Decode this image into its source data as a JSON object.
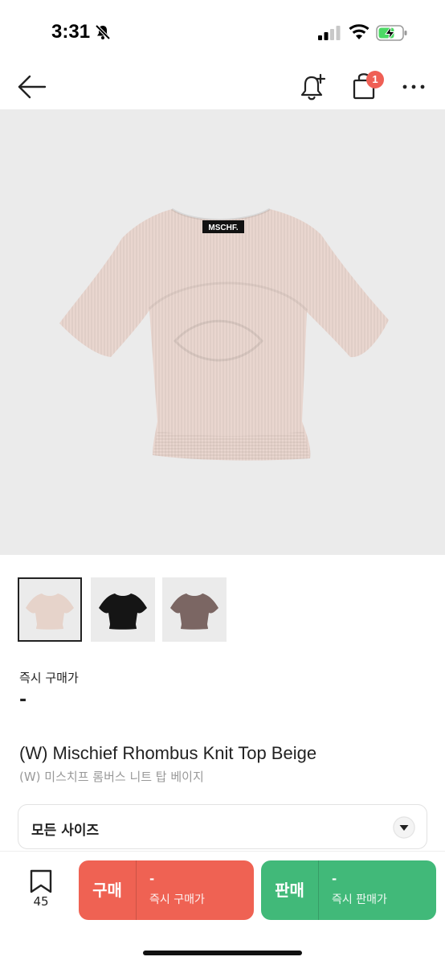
{
  "status_bar": {
    "time": "3:31"
  },
  "nav": {
    "cart_count": "1"
  },
  "product": {
    "brand_label": "MSCHF.",
    "image_color": "#e9d6cf",
    "thumbnails": [
      {
        "color": "#e6d3ca",
        "selected": true
      },
      {
        "color": "#151515",
        "selected": false
      },
      {
        "color": "#7b6663",
        "selected": false
      }
    ],
    "price_label": "즉시 구매가",
    "price_value": "-",
    "name": "(W) Mischief Rhombus Knit Top Beige",
    "name_ko": "(W) 미스치프 롬버스 니트 탑 베이지"
  },
  "size_select": {
    "label": "모든 사이즈"
  },
  "bottom_bar": {
    "bookmark_count": "45",
    "buy": {
      "label": "구매",
      "price": "-",
      "sub": "즉시 구매가",
      "color": "#ef6253"
    },
    "sell": {
      "label": "판매",
      "price": "-",
      "sub": "즉시 판매가",
      "color": "#41b979"
    }
  }
}
